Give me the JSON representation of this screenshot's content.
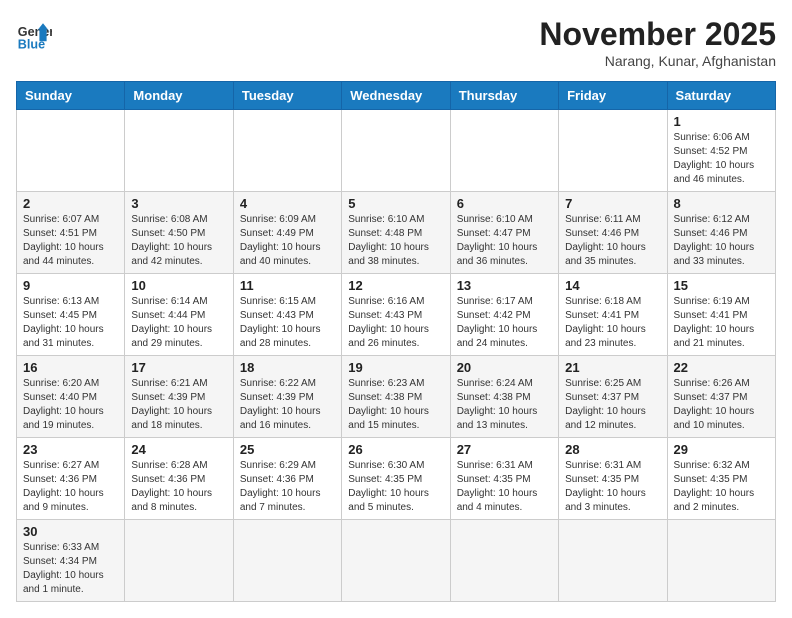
{
  "logo": {
    "text_general": "General",
    "text_blue": "Blue"
  },
  "title": "November 2025",
  "subtitle": "Narang, Kunar, Afghanistan",
  "weekdays": [
    "Sunday",
    "Monday",
    "Tuesday",
    "Wednesday",
    "Thursday",
    "Friday",
    "Saturday"
  ],
  "weeks": [
    [
      {
        "day": "",
        "info": ""
      },
      {
        "day": "",
        "info": ""
      },
      {
        "day": "",
        "info": ""
      },
      {
        "day": "",
        "info": ""
      },
      {
        "day": "",
        "info": ""
      },
      {
        "day": "",
        "info": ""
      },
      {
        "day": "1",
        "info": "Sunrise: 6:06 AM\nSunset: 4:52 PM\nDaylight: 10 hours and 46 minutes."
      }
    ],
    [
      {
        "day": "2",
        "info": "Sunrise: 6:07 AM\nSunset: 4:51 PM\nDaylight: 10 hours and 44 minutes."
      },
      {
        "day": "3",
        "info": "Sunrise: 6:08 AM\nSunset: 4:50 PM\nDaylight: 10 hours and 42 minutes."
      },
      {
        "day": "4",
        "info": "Sunrise: 6:09 AM\nSunset: 4:49 PM\nDaylight: 10 hours and 40 minutes."
      },
      {
        "day": "5",
        "info": "Sunrise: 6:10 AM\nSunset: 4:48 PM\nDaylight: 10 hours and 38 minutes."
      },
      {
        "day": "6",
        "info": "Sunrise: 6:10 AM\nSunset: 4:47 PM\nDaylight: 10 hours and 36 minutes."
      },
      {
        "day": "7",
        "info": "Sunrise: 6:11 AM\nSunset: 4:46 PM\nDaylight: 10 hours and 35 minutes."
      },
      {
        "day": "8",
        "info": "Sunrise: 6:12 AM\nSunset: 4:46 PM\nDaylight: 10 hours and 33 minutes."
      }
    ],
    [
      {
        "day": "9",
        "info": "Sunrise: 6:13 AM\nSunset: 4:45 PM\nDaylight: 10 hours and 31 minutes."
      },
      {
        "day": "10",
        "info": "Sunrise: 6:14 AM\nSunset: 4:44 PM\nDaylight: 10 hours and 29 minutes."
      },
      {
        "day": "11",
        "info": "Sunrise: 6:15 AM\nSunset: 4:43 PM\nDaylight: 10 hours and 28 minutes."
      },
      {
        "day": "12",
        "info": "Sunrise: 6:16 AM\nSunset: 4:43 PM\nDaylight: 10 hours and 26 minutes."
      },
      {
        "day": "13",
        "info": "Sunrise: 6:17 AM\nSunset: 4:42 PM\nDaylight: 10 hours and 24 minutes."
      },
      {
        "day": "14",
        "info": "Sunrise: 6:18 AM\nSunset: 4:41 PM\nDaylight: 10 hours and 23 minutes."
      },
      {
        "day": "15",
        "info": "Sunrise: 6:19 AM\nSunset: 4:41 PM\nDaylight: 10 hours and 21 minutes."
      }
    ],
    [
      {
        "day": "16",
        "info": "Sunrise: 6:20 AM\nSunset: 4:40 PM\nDaylight: 10 hours and 19 minutes."
      },
      {
        "day": "17",
        "info": "Sunrise: 6:21 AM\nSunset: 4:39 PM\nDaylight: 10 hours and 18 minutes."
      },
      {
        "day": "18",
        "info": "Sunrise: 6:22 AM\nSunset: 4:39 PM\nDaylight: 10 hours and 16 minutes."
      },
      {
        "day": "19",
        "info": "Sunrise: 6:23 AM\nSunset: 4:38 PM\nDaylight: 10 hours and 15 minutes."
      },
      {
        "day": "20",
        "info": "Sunrise: 6:24 AM\nSunset: 4:38 PM\nDaylight: 10 hours and 13 minutes."
      },
      {
        "day": "21",
        "info": "Sunrise: 6:25 AM\nSunset: 4:37 PM\nDaylight: 10 hours and 12 minutes."
      },
      {
        "day": "22",
        "info": "Sunrise: 6:26 AM\nSunset: 4:37 PM\nDaylight: 10 hours and 10 minutes."
      }
    ],
    [
      {
        "day": "23",
        "info": "Sunrise: 6:27 AM\nSunset: 4:36 PM\nDaylight: 10 hours and 9 minutes."
      },
      {
        "day": "24",
        "info": "Sunrise: 6:28 AM\nSunset: 4:36 PM\nDaylight: 10 hours and 8 minutes."
      },
      {
        "day": "25",
        "info": "Sunrise: 6:29 AM\nSunset: 4:36 PM\nDaylight: 10 hours and 7 minutes."
      },
      {
        "day": "26",
        "info": "Sunrise: 6:30 AM\nSunset: 4:35 PM\nDaylight: 10 hours and 5 minutes."
      },
      {
        "day": "27",
        "info": "Sunrise: 6:31 AM\nSunset: 4:35 PM\nDaylight: 10 hours and 4 minutes."
      },
      {
        "day": "28",
        "info": "Sunrise: 6:31 AM\nSunset: 4:35 PM\nDaylight: 10 hours and 3 minutes."
      },
      {
        "day": "29",
        "info": "Sunrise: 6:32 AM\nSunset: 4:35 PM\nDaylight: 10 hours and 2 minutes."
      }
    ],
    [
      {
        "day": "30",
        "info": "Sunrise: 6:33 AM\nSunset: 4:34 PM\nDaylight: 10 hours and 1 minute."
      },
      {
        "day": "",
        "info": ""
      },
      {
        "day": "",
        "info": ""
      },
      {
        "day": "",
        "info": ""
      },
      {
        "day": "",
        "info": ""
      },
      {
        "day": "",
        "info": ""
      },
      {
        "day": "",
        "info": ""
      }
    ]
  ]
}
